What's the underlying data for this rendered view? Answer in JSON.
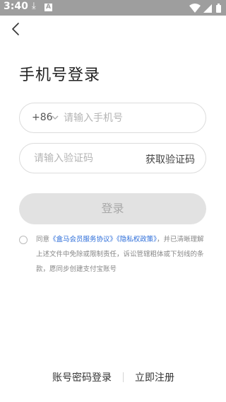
{
  "status_bar": {
    "time": "3:40",
    "download_glyph": "⤓",
    "notif_letter": "A",
    "icons": [
      "download-icon",
      "notification-a-icon",
      "wifi-icon",
      "signal-icon",
      "battery-icon"
    ]
  },
  "nav": {
    "back_icon": "chevron-left-icon"
  },
  "page": {
    "title": "手机号登录"
  },
  "phone_field": {
    "country_code": "+86",
    "chevron_icon": "chevron-down-icon",
    "placeholder": "请输入手机号",
    "value": ""
  },
  "code_field": {
    "placeholder": "请输入验证码",
    "value": "",
    "get_code_label": "获取验证码"
  },
  "login_button": {
    "label": "登录"
  },
  "agreement": {
    "checked": false,
    "prefix": "同意",
    "link1": "《盒马会员服务协议》",
    "link2": "《隐私权政策》",
    "suffix": "，并已清晰理解上述文件中免除或限制责任，诉讼管辖粗体或下划线的条款，愿同步创建支付宝账号"
  },
  "bottom_links": {
    "password_login": "账号密码登录",
    "register": "立即注册"
  },
  "colors": {
    "status_bar": "#9e9e9e",
    "link": "#2b6cd9",
    "button_disabled_bg": "#e2e2e2",
    "button_disabled_text": "#a8a8a8"
  }
}
